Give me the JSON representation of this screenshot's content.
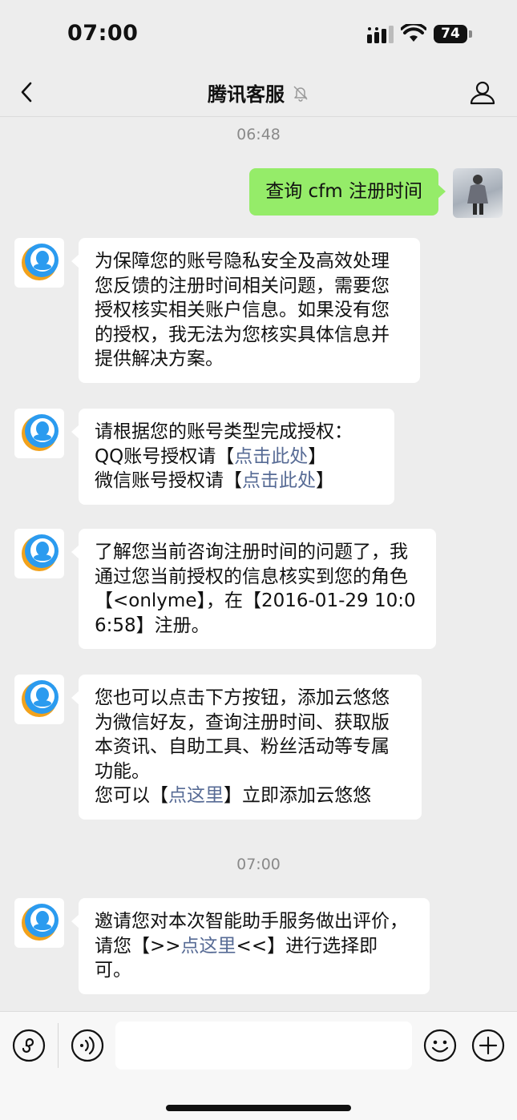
{
  "status_bar": {
    "time": "07:00",
    "battery": "74"
  },
  "nav": {
    "title": "腾讯客服"
  },
  "timestamps": [
    "06:48",
    "07:00"
  ],
  "messages": [
    {
      "from": "user",
      "text": "查询 cfm 注册时间"
    },
    {
      "from": "bot",
      "text": "为保障您的账号隐私安全及高效处理您反馈的注册时间相关问题，需要您授权核实相关账户信息。如果没有您的授权，我无法为您核实具体信息并提供解决方案。"
    },
    {
      "from": "bot",
      "line1": "请根据您的账号类型完成授权：",
      "line2_prefix": "QQ账号授权请【",
      "line2_link": "点击此处",
      "line2_suffix": "】",
      "line3_prefix": "微信账号授权请【",
      "line3_link": "点击此处",
      "line3_suffix": "】"
    },
    {
      "from": "bot",
      "text": "了解您当前咨询注册时间的问题了，我通过您当前授权的信息核实到您的角色【<onlyme】，在【2016-01-29 10:06:58】注册。"
    },
    {
      "from": "bot",
      "text": "您也可以点击下方按钮，添加云悠悠为微信好友，查询注册时间、获取版本资讯、自助工具、粉丝活动等专属功能。",
      "line2_prefix": "您可以【",
      "line2_link": "点这里",
      "line2_suffix": "】立即添加云悠悠"
    },
    {
      "from": "bot",
      "prefix": "邀请您对本次智能助手服务做出评价，请您【>>",
      "link": "点这里",
      "suffix": "<<】进行选择即可。"
    }
  ],
  "input": {
    "placeholder": ""
  },
  "colors": {
    "bubble_out": "#95ec69",
    "link": "#576b95",
    "background": "#ededed",
    "avatar_blue": "#2b9bef",
    "avatar_orange": "#f2a21c"
  }
}
